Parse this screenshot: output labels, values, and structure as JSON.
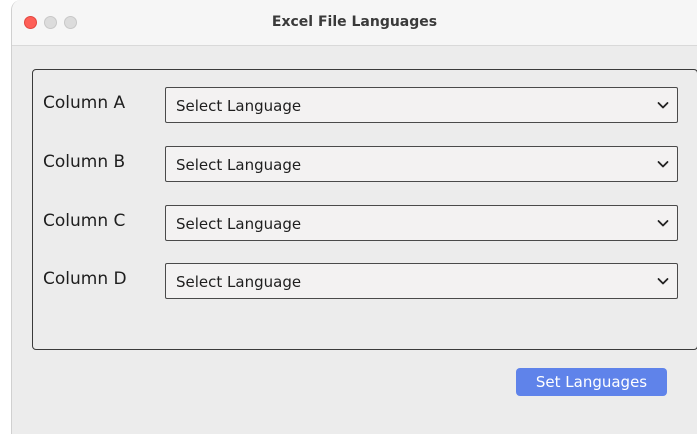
{
  "window": {
    "title": "Excel File Languages"
  },
  "colors": {
    "accent": "#5f83ea",
    "close": "#fe5f57",
    "inactive_control": "#dcdcdc"
  },
  "rows": [
    {
      "label": "Column A",
      "selected": "Select Language"
    },
    {
      "label": "Column B",
      "selected": "Select Language"
    },
    {
      "label": "Column C",
      "selected": "Select Language"
    },
    {
      "label": "Column D",
      "selected": "Select Language"
    }
  ],
  "actions": {
    "set_languages_label": "Set Languages"
  },
  "icons": {
    "dropdown": "chevron-down-icon"
  }
}
